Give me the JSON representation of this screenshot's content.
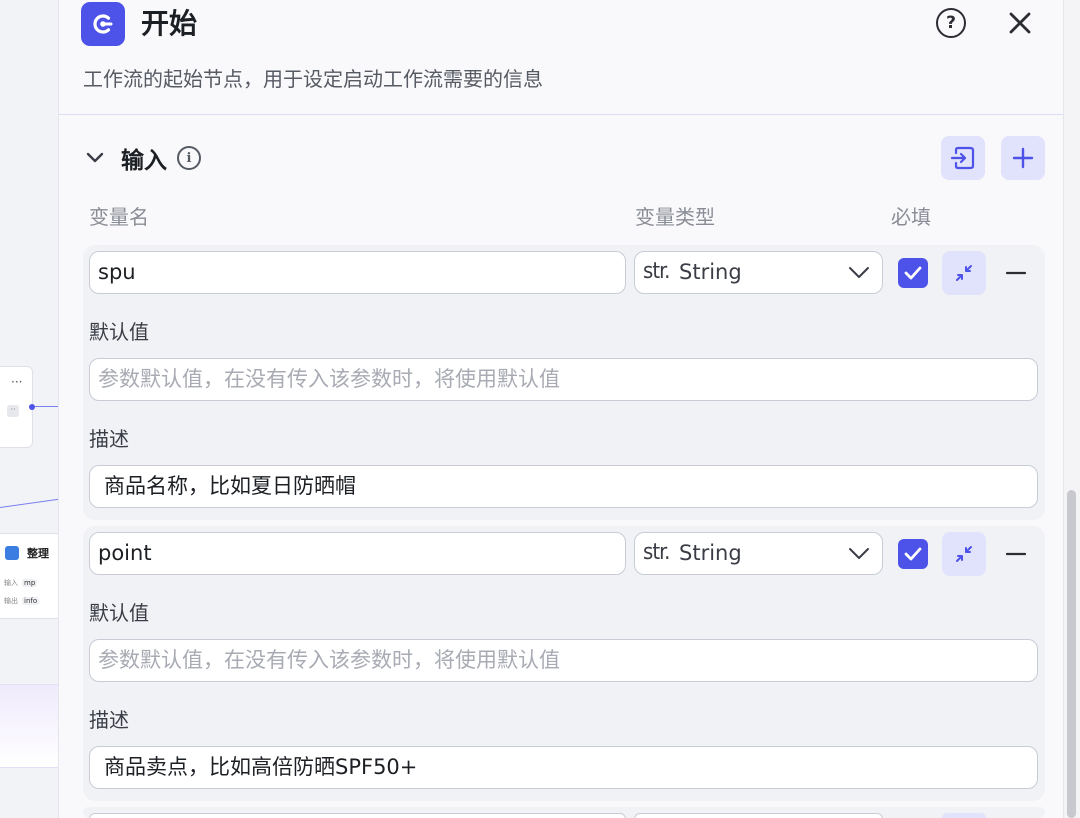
{
  "panel": {
    "title": "开始",
    "subtitle": "工作流的起始节点，用于设定启动工作流需要的信息",
    "help_label": "?",
    "section": {
      "title": "输入",
      "info_label": "i"
    },
    "columns": {
      "name": "变量名",
      "type": "变量类型",
      "required": "必填"
    },
    "variables": [
      {
        "name": "spu",
        "type_prefix": "str.",
        "type": "String",
        "required": true,
        "default_label": "默认值",
        "default_placeholder": "参数默认值，在没有传入该参数时，将使用默认值",
        "desc_label": "描述",
        "desc_value": "商品名称，比如夏日防晒帽"
      },
      {
        "name": "point",
        "type_prefix": "str.",
        "type": "String",
        "required": true,
        "default_label": "默认值",
        "default_placeholder": "参数默认值，在没有传入该参数时，将使用默认值",
        "desc_label": "描述",
        "desc_value": "商品卖点，比如高倍防晒SPF50+"
      }
    ]
  },
  "background_canvas": {
    "node_title": "整理",
    "input_label": "输入",
    "output_label": "输出",
    "input_value": "mp",
    "output_value": "info"
  },
  "colors": {
    "accent": "#4d53e8",
    "accent_light": "#e1e2fb"
  }
}
